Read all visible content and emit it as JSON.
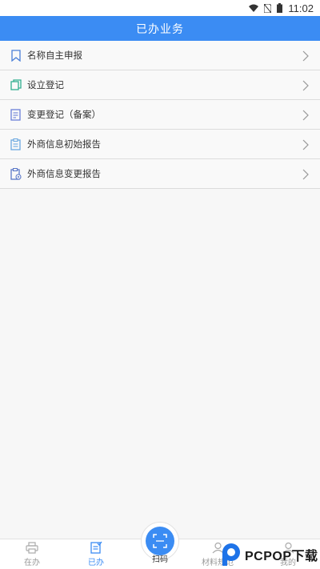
{
  "status_bar": {
    "time": "11:02"
  },
  "header": {
    "title": "已办业务"
  },
  "list": [
    {
      "label": "名称自主申报",
      "icon": "bookmark-icon"
    },
    {
      "label": "设立登记",
      "icon": "copy-icon"
    },
    {
      "label": "变更登记（备案）",
      "icon": "document-edit-icon"
    },
    {
      "label": "外商信息初始报告",
      "icon": "clipboard-list-icon"
    },
    {
      "label": "外商信息变更报告",
      "icon": "clipboard-gear-icon"
    }
  ],
  "tabbar": {
    "tabs": [
      {
        "label": "在办",
        "icon": "printer-icon"
      },
      {
        "label": "已办",
        "icon": "checklist-icon",
        "active": true
      },
      {
        "label": "扫码",
        "icon": "scan-icon"
      },
      {
        "label": "材料规范",
        "icon": "user-icon"
      },
      {
        "label": "我的",
        "icon": "profile-icon"
      }
    ]
  },
  "watermark": {
    "text": "PCPOP下载"
  },
  "colors": {
    "accent": "#3b8cf3",
    "active_tab": "#3b8cf3",
    "inactive_tab": "#9a9a9a"
  }
}
